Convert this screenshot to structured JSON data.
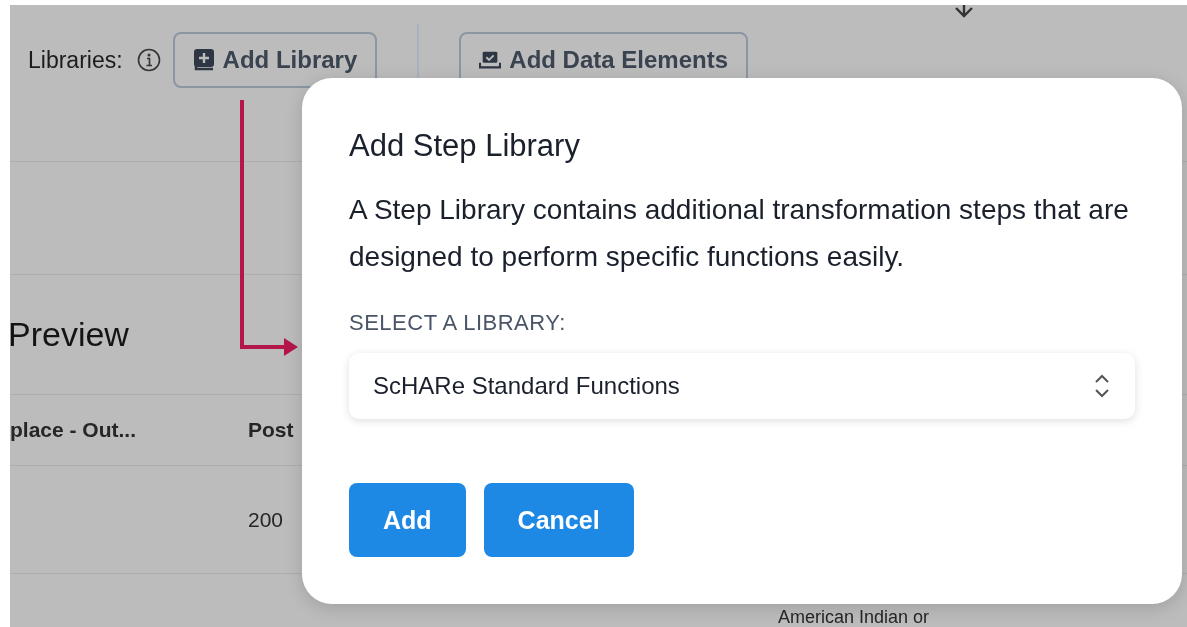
{
  "toolbar": {
    "label": "Libraries:",
    "add_library_button": "Add Library",
    "add_data_elements_button": "Add Data Elements"
  },
  "preview": {
    "title": "Preview",
    "columns": [
      "place - Out...",
      "Post"
    ],
    "rows": [
      {
        "column_1": "",
        "column_2": "200"
      }
    ],
    "cut_text": "American Indian or"
  },
  "dialog": {
    "title": "Add Step Library",
    "description": "A Step Library contains additional transformation steps that are designed to perform specific functions easily.",
    "select_label": "SELECT A LIBRARY:",
    "select": {
      "value": "ScHARe Standard Functions"
    },
    "buttons": [
      {
        "label": "Add"
      },
      {
        "label": "Cancel"
      }
    ]
  }
}
